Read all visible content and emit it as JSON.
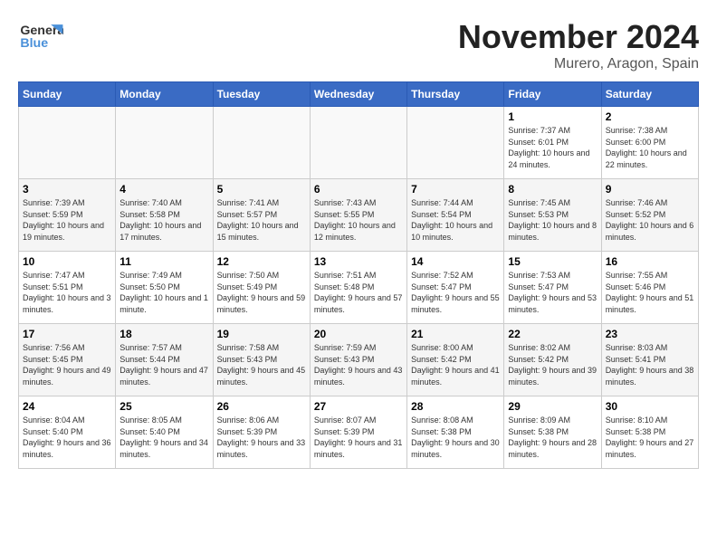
{
  "header": {
    "logo_text1": "General",
    "logo_text2": "Blue",
    "month": "November 2024",
    "location": "Murero, Aragon, Spain"
  },
  "days_of_week": [
    "Sunday",
    "Monday",
    "Tuesday",
    "Wednesday",
    "Thursday",
    "Friday",
    "Saturday"
  ],
  "weeks": [
    [
      {
        "day": "",
        "info": ""
      },
      {
        "day": "",
        "info": ""
      },
      {
        "day": "",
        "info": ""
      },
      {
        "day": "",
        "info": ""
      },
      {
        "day": "",
        "info": ""
      },
      {
        "day": "1",
        "info": "Sunrise: 7:37 AM\nSunset: 6:01 PM\nDaylight: 10 hours and 24 minutes."
      },
      {
        "day": "2",
        "info": "Sunrise: 7:38 AM\nSunset: 6:00 PM\nDaylight: 10 hours and 22 minutes."
      }
    ],
    [
      {
        "day": "3",
        "info": "Sunrise: 7:39 AM\nSunset: 5:59 PM\nDaylight: 10 hours and 19 minutes."
      },
      {
        "day": "4",
        "info": "Sunrise: 7:40 AM\nSunset: 5:58 PM\nDaylight: 10 hours and 17 minutes."
      },
      {
        "day": "5",
        "info": "Sunrise: 7:41 AM\nSunset: 5:57 PM\nDaylight: 10 hours and 15 minutes."
      },
      {
        "day": "6",
        "info": "Sunrise: 7:43 AM\nSunset: 5:55 PM\nDaylight: 10 hours and 12 minutes."
      },
      {
        "day": "7",
        "info": "Sunrise: 7:44 AM\nSunset: 5:54 PM\nDaylight: 10 hours and 10 minutes."
      },
      {
        "day": "8",
        "info": "Sunrise: 7:45 AM\nSunset: 5:53 PM\nDaylight: 10 hours and 8 minutes."
      },
      {
        "day": "9",
        "info": "Sunrise: 7:46 AM\nSunset: 5:52 PM\nDaylight: 10 hours and 6 minutes."
      }
    ],
    [
      {
        "day": "10",
        "info": "Sunrise: 7:47 AM\nSunset: 5:51 PM\nDaylight: 10 hours and 3 minutes."
      },
      {
        "day": "11",
        "info": "Sunrise: 7:49 AM\nSunset: 5:50 PM\nDaylight: 10 hours and 1 minute."
      },
      {
        "day": "12",
        "info": "Sunrise: 7:50 AM\nSunset: 5:49 PM\nDaylight: 9 hours and 59 minutes."
      },
      {
        "day": "13",
        "info": "Sunrise: 7:51 AM\nSunset: 5:48 PM\nDaylight: 9 hours and 57 minutes."
      },
      {
        "day": "14",
        "info": "Sunrise: 7:52 AM\nSunset: 5:47 PM\nDaylight: 9 hours and 55 minutes."
      },
      {
        "day": "15",
        "info": "Sunrise: 7:53 AM\nSunset: 5:47 PM\nDaylight: 9 hours and 53 minutes."
      },
      {
        "day": "16",
        "info": "Sunrise: 7:55 AM\nSunset: 5:46 PM\nDaylight: 9 hours and 51 minutes."
      }
    ],
    [
      {
        "day": "17",
        "info": "Sunrise: 7:56 AM\nSunset: 5:45 PM\nDaylight: 9 hours and 49 minutes."
      },
      {
        "day": "18",
        "info": "Sunrise: 7:57 AM\nSunset: 5:44 PM\nDaylight: 9 hours and 47 minutes."
      },
      {
        "day": "19",
        "info": "Sunrise: 7:58 AM\nSunset: 5:43 PM\nDaylight: 9 hours and 45 minutes."
      },
      {
        "day": "20",
        "info": "Sunrise: 7:59 AM\nSunset: 5:43 PM\nDaylight: 9 hours and 43 minutes."
      },
      {
        "day": "21",
        "info": "Sunrise: 8:00 AM\nSunset: 5:42 PM\nDaylight: 9 hours and 41 minutes."
      },
      {
        "day": "22",
        "info": "Sunrise: 8:02 AM\nSunset: 5:42 PM\nDaylight: 9 hours and 39 minutes."
      },
      {
        "day": "23",
        "info": "Sunrise: 8:03 AM\nSunset: 5:41 PM\nDaylight: 9 hours and 38 minutes."
      }
    ],
    [
      {
        "day": "24",
        "info": "Sunrise: 8:04 AM\nSunset: 5:40 PM\nDaylight: 9 hours and 36 minutes."
      },
      {
        "day": "25",
        "info": "Sunrise: 8:05 AM\nSunset: 5:40 PM\nDaylight: 9 hours and 34 minutes."
      },
      {
        "day": "26",
        "info": "Sunrise: 8:06 AM\nSunset: 5:39 PM\nDaylight: 9 hours and 33 minutes."
      },
      {
        "day": "27",
        "info": "Sunrise: 8:07 AM\nSunset: 5:39 PM\nDaylight: 9 hours and 31 minutes."
      },
      {
        "day": "28",
        "info": "Sunrise: 8:08 AM\nSunset: 5:38 PM\nDaylight: 9 hours and 30 minutes."
      },
      {
        "day": "29",
        "info": "Sunrise: 8:09 AM\nSunset: 5:38 PM\nDaylight: 9 hours and 28 minutes."
      },
      {
        "day": "30",
        "info": "Sunrise: 8:10 AM\nSunset: 5:38 PM\nDaylight: 9 hours and 27 minutes."
      }
    ]
  ]
}
